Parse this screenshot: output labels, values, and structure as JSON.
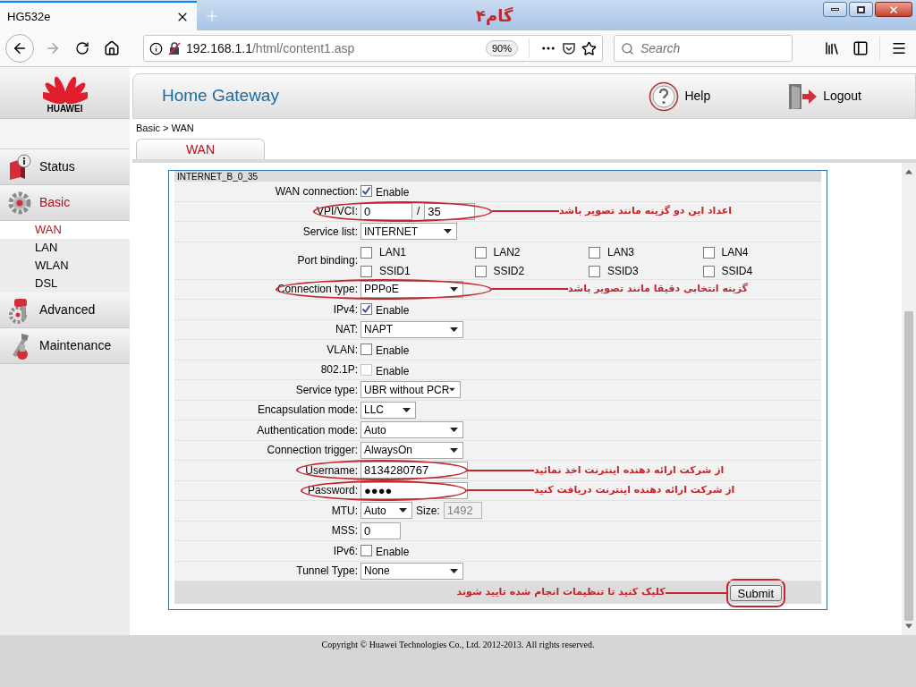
{
  "browser": {
    "tab_title": "HG532e",
    "overlay_title": "گام۴",
    "url_host": "192.168.1.1",
    "url_path": "/html/content1.asp",
    "zoom": "90%",
    "search_placeholder": "Search"
  },
  "sidebar": {
    "brand": "HUAWEI",
    "items": [
      {
        "kind": "status",
        "label": "Status",
        "selected": false
      },
      {
        "kind": "basic",
        "label": "Basic",
        "selected": true,
        "children": [
          {
            "label": "WAN",
            "selected": true
          },
          {
            "label": "LAN",
            "selected": false
          },
          {
            "label": "WLAN",
            "selected": false
          },
          {
            "label": "DSL",
            "selected": false
          }
        ]
      },
      {
        "kind": "advanced",
        "label": "Advanced",
        "selected": false
      },
      {
        "kind": "maintenance",
        "label": "Maintenance",
        "selected": false
      }
    ]
  },
  "header": {
    "title": "Home Gateway",
    "help": "Help",
    "logout": "Logout"
  },
  "breadcrumb": "Basic > WAN",
  "page_tab": {
    "label": "WAN",
    "selected": true
  },
  "form": {
    "section_title": "INTERNET_B_0_35",
    "rows": [
      {
        "kind": "checkbox",
        "label": "WAN connection:",
        "option": "Enable",
        "checked": true,
        "disabled": false
      },
      {
        "kind": "pair",
        "label": "VPI/VCI:",
        "values": [
          "0",
          "35"
        ],
        "separator": "/",
        "annotation": "اعداد این دو گزینه مانند تصویر باشد"
      },
      {
        "kind": "select",
        "label": "Service list:",
        "value": "INTERNET"
      },
      {
        "kind": "ports",
        "label": "Port binding:",
        "ports": [
          {
            "name": "LAN1",
            "checked": false
          },
          {
            "name": "LAN2",
            "checked": false
          },
          {
            "name": "LAN3",
            "checked": false
          },
          {
            "name": "LAN4",
            "checked": false
          },
          {
            "name": "SSID1",
            "checked": false
          },
          {
            "name": "SSID2",
            "checked": false
          },
          {
            "name": "SSID3",
            "checked": false
          },
          {
            "name": "SSID4",
            "checked": false
          }
        ]
      },
      {
        "kind": "select",
        "label": "Connection type:",
        "value": "PPPoE",
        "annotation": "گزینه انتخابی دقیقا مانند تصویر باشد"
      },
      {
        "kind": "checkbox",
        "label": "IPv4:",
        "option": "Enable",
        "checked": true,
        "disabled": false
      },
      {
        "kind": "select",
        "label": "NAT:",
        "value": "NAPT"
      },
      {
        "kind": "checkbox",
        "label": "VLAN:",
        "option": "Enable",
        "checked": false,
        "disabled": false
      },
      {
        "kind": "checkbox",
        "label": "802.1P:",
        "option": "Enable",
        "checked": false,
        "disabled": true
      },
      {
        "kind": "select",
        "label": "Service type:",
        "value": "UBR without PCR"
      },
      {
        "kind": "select",
        "label": "Encapsulation mode:",
        "value": "LLC"
      },
      {
        "kind": "select",
        "label": "Authentication mode:",
        "value": "Auto"
      },
      {
        "kind": "select",
        "label": "Connection trigger:",
        "value": "AlwaysOn"
      },
      {
        "kind": "text",
        "label": "Username:",
        "value": "8134280767",
        "annotation": "از شرکت ارائه دهنده اینترنت اخذ نمائید"
      },
      {
        "kind": "password",
        "label": "Password:",
        "value": "●●●●",
        "annotation": "از شرکت ارائه دهنده اینترنت دریافت کنید"
      },
      {
        "kind": "mtu",
        "label": "MTU:",
        "value": "Auto",
        "size_label": "Size:",
        "size_value": "1492"
      },
      {
        "kind": "text",
        "label": "MSS:",
        "value": "0"
      },
      {
        "kind": "checkbox",
        "label": "IPv6:",
        "option": "Enable",
        "checked": false,
        "disabled": false
      },
      {
        "kind": "select",
        "label": "Tunnel Type:",
        "value": "None"
      }
    ],
    "submit": {
      "label": "Submit",
      "annotation": "کلیک کنید تا تنظیمات انجام شده تایید شوند"
    }
  },
  "footer": "Copyright © Huawei Technologies Co., Ltd. 2012-2013. All rights reserved."
}
